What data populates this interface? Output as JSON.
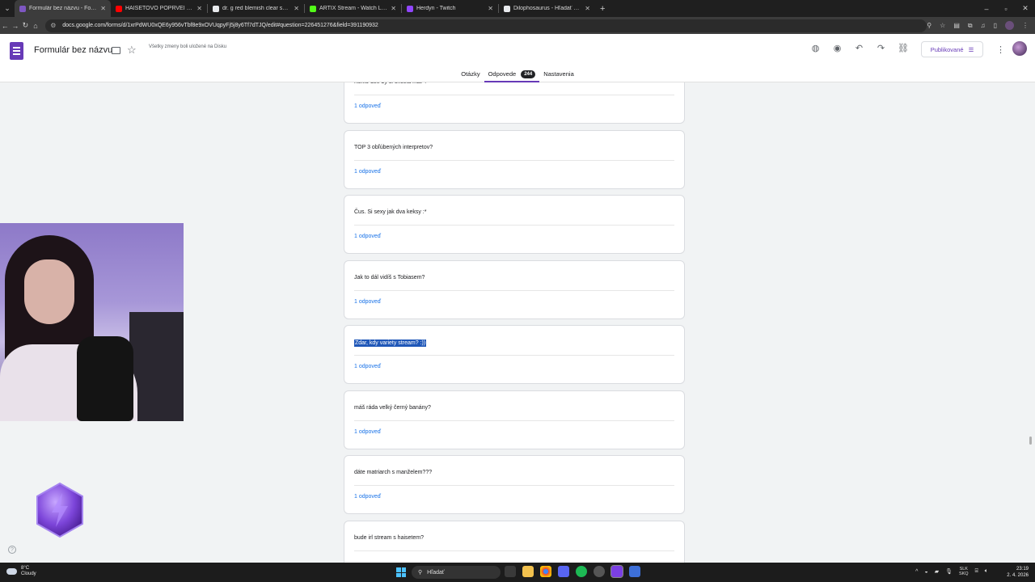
{
  "browser": {
    "tabs": [
      {
        "title": "Formulár bez názvu - Formulá",
        "active": true,
        "favicon_color": "#7e57c2"
      },
      {
        "title": "HAISETOVO POPRVEÍ on to fai",
        "active": false,
        "favicon_color": "#ff0000"
      },
      {
        "title": "dr. g red blemish clear soothin",
        "active": false,
        "favicon_color": "#e8eaed"
      },
      {
        "title": "ARTIX Stream - Watch Live on",
        "active": false,
        "favicon_color": "#53fc18"
      },
      {
        "title": "Herdyn - Twitch",
        "active": false,
        "favicon_color": "#9146ff"
      },
      {
        "title": "Dilophosaurus - Hľadať Googl",
        "active": false,
        "favicon_color": "#e8eaed"
      }
    ],
    "url": "docs.google.com/forms/d/1xrPdWU0xQE6y956vTbf8e9xOVUqpyFj5j8y6Tf7dTJQ/edit#question=226451276&field=391190932"
  },
  "forms": {
    "title": "Formulár bez názvu",
    "save_status": "Všetky zmeny boli uložené na Disku",
    "publish_label": "Publikované",
    "tabs": {
      "questions": "Otázky",
      "responses": "Odpovede",
      "responses_count": "244",
      "settings": "Nastavenia"
    }
  },
  "questions": [
    {
      "text": "Koľko detí by si chcela mať ?",
      "responses": "1 odpoveď"
    },
    {
      "text": "TOP 3 obľúbených interpretov?",
      "responses": "1 odpoveď"
    },
    {
      "text": "Čus. Si sexy jak dva keksy :*",
      "responses": "1 odpoveď"
    },
    {
      "text": "Jak to dál vidíš s Tobiasem?",
      "responses": "1 odpoveď"
    },
    {
      "text": "Zdar, kdy variety stream? :))",
      "responses": "1 odpoveď",
      "highlighted": true
    },
    {
      "text": "máš ráda velký černý banány?",
      "responses": "1 odpoveď"
    },
    {
      "text": "dáte matriarch s manželem???",
      "responses": "1 odpoveď"
    },
    {
      "text": "bude irl stream s haisetem?",
      "responses": ""
    }
  ],
  "taskbar": {
    "weather_temp": "8°C",
    "weather_desc": "Cloudy",
    "search_placeholder": "Hľadať",
    "lang_top": "SLK",
    "lang_bottom": "SKQ",
    "time": "23:19",
    "date": "2. 4. 2026"
  },
  "colors": {
    "accent": "#673ab7",
    "link": "#1a73e8",
    "selection": "#1f57b8"
  }
}
